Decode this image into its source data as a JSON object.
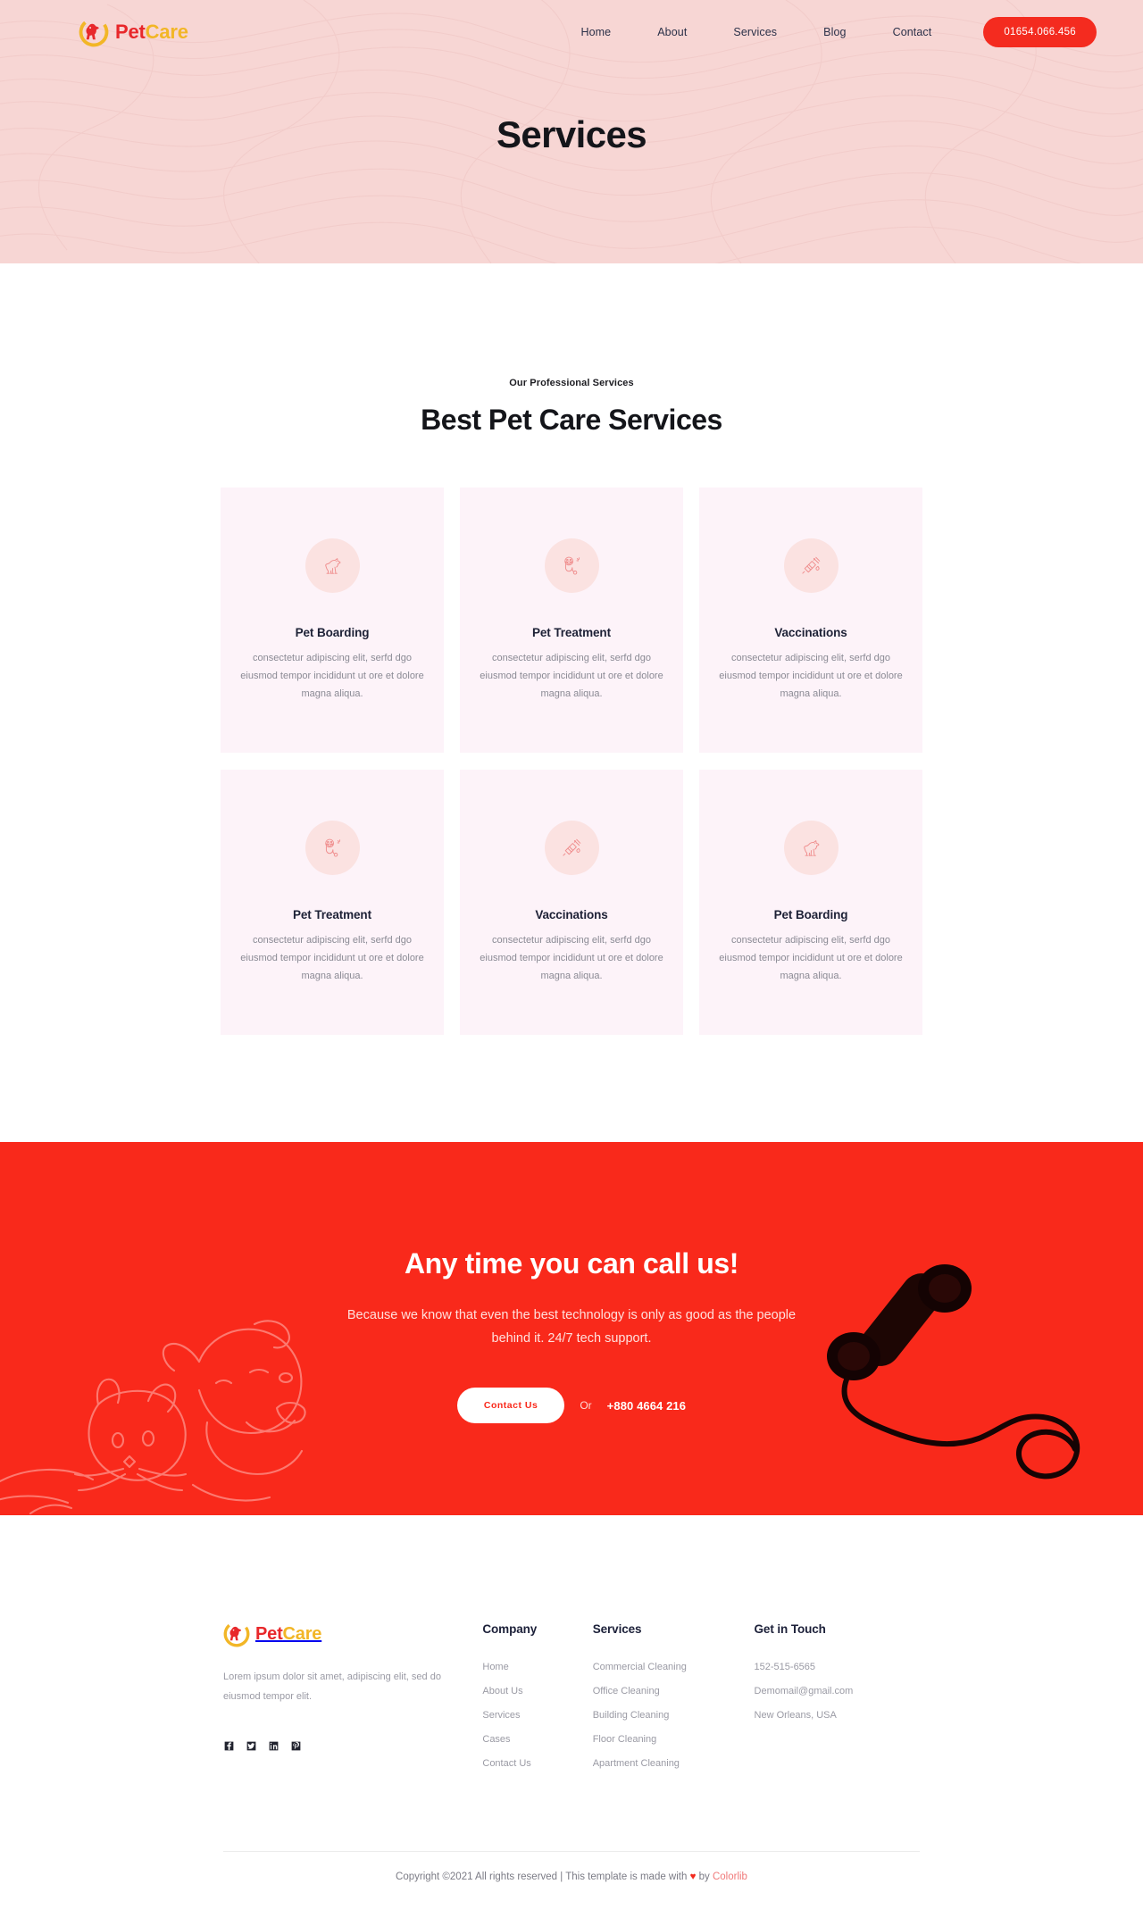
{
  "brand": {
    "name_first": "Pet",
    "name_second": "Care",
    "icon": "dog-logo-icon",
    "color_first": "#e8282b",
    "color_second": "#f2b626"
  },
  "header": {
    "nav": [
      {
        "label": "Home",
        "name": "nav-link-home"
      },
      {
        "label": "About",
        "name": "nav-link-about"
      },
      {
        "label": "Services",
        "name": "nav-link-services"
      },
      {
        "label": "Blog",
        "name": "nav-link-blog"
      },
      {
        "label": "Contact",
        "name": "nav-link-contact"
      }
    ],
    "phone_button": "01654.066.456",
    "phone_button_color": "#f42b1f"
  },
  "hero": {
    "title": "Services",
    "background_color": "#f7d6d4",
    "pattern": "topographic-contour-lines"
  },
  "services": {
    "subtitle": "Our Professional Services",
    "title": "Best Pet Care Services",
    "card_background": "#fdf3f9",
    "icon_background": "#fbe2e1",
    "icon_stroke": "#ef8c8c",
    "cards": [
      {
        "icon": "dog-sitting-icon",
        "title": "Pet Boarding",
        "description": "consectetur adipiscing elit, serfd dgo eiusmod tempor incididunt ut ore et dolore magna aliqua."
      },
      {
        "icon": "stethoscope-paw-icon",
        "title": "Pet Treatment",
        "description": "consectetur adipiscing elit, serfd dgo eiusmod tempor incididunt ut ore et dolore magna aliqua."
      },
      {
        "icon": "syringe-vaccine-icon",
        "title": "Vaccinations",
        "description": "consectetur adipiscing elit, serfd dgo eiusmod tempor incididunt ut ore et dolore magna aliqua."
      },
      {
        "icon": "stethoscope-paw-icon",
        "title": "Pet Treatment",
        "description": "consectetur adipiscing elit, serfd dgo eiusmod tempor incididunt ut ore et dolore magna aliqua."
      },
      {
        "icon": "syringe-vaccine-icon",
        "title": "Vaccinations",
        "description": "consectetur adipiscing elit, serfd dgo eiusmod tempor incididunt ut ore et dolore magna aliqua."
      },
      {
        "icon": "dog-sitting-icon",
        "title": "Pet Boarding",
        "description": "consectetur adipiscing elit, serfd dgo eiusmod tempor incididunt ut ore et dolore magna aliqua."
      }
    ]
  },
  "cta": {
    "title": "Any time you can call us!",
    "text": "Because we know that even the best technology is only as good as the people behind it. 24/7 tech support.",
    "button": "Contact Us",
    "or": "Or",
    "phone": "+880 4664 216",
    "background_color": "#f9291b",
    "left_art": "dog-and-cat-line-art",
    "right_art": "telephone-handset-with-cord"
  },
  "footer": {
    "tagline": "Lorem ipsum dolor sit amet, adipiscing elit, sed do eiusmod tempor elit.",
    "social": [
      {
        "name": "facebook-icon",
        "label": "Facebook"
      },
      {
        "name": "twitter-icon",
        "label": "Twitter"
      },
      {
        "name": "linkedin-icon",
        "label": "LinkedIn"
      },
      {
        "name": "pinterest-icon",
        "label": "Pinterest"
      }
    ],
    "company": {
      "heading": "Company",
      "links": [
        "Home",
        "About Us",
        "Services",
        "Cases",
        "Contact Us"
      ]
    },
    "services": {
      "heading": "Services",
      "links": [
        "Commercial Cleaning",
        "Office Cleaning",
        "Building Cleaning",
        "Floor Cleaning",
        "Apartment Cleaning"
      ]
    },
    "touch": {
      "heading": "Get in Touch",
      "phone": "152-515-6565",
      "email": "Demomail@gmail.com",
      "address": "New Orleans, USA"
    },
    "copyright_prefix": "Copyright ©2021 All rights reserved | This template is made with ",
    "copyright_heart": "♥",
    "copyright_by": " by ",
    "copyright_brand": "Colorlib"
  }
}
